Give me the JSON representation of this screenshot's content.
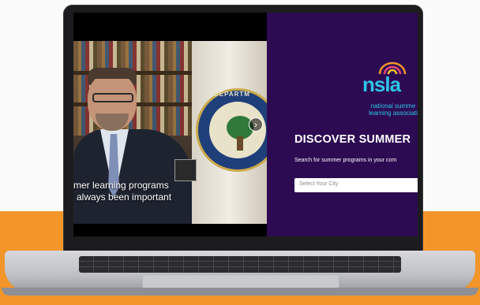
{
  "video": {
    "caption_line1": "mer learning programs",
    "caption_line2": "always been important",
    "seal_text": "DEPARTM",
    "next_button": "›"
  },
  "panel": {
    "logo_word": "nsla",
    "org_name_line1": "national summe",
    "org_name_line2": "learning associati",
    "heading": "DISCOVER SUMMER",
    "subtext": "Search for summer programs in your com",
    "city_select": {
      "placeholder": "Select Your City"
    }
  },
  "colors": {
    "panel_bg": "#2d0b52",
    "brand_cyan": "#2ec4e6",
    "orange_band": "#f2962a"
  }
}
